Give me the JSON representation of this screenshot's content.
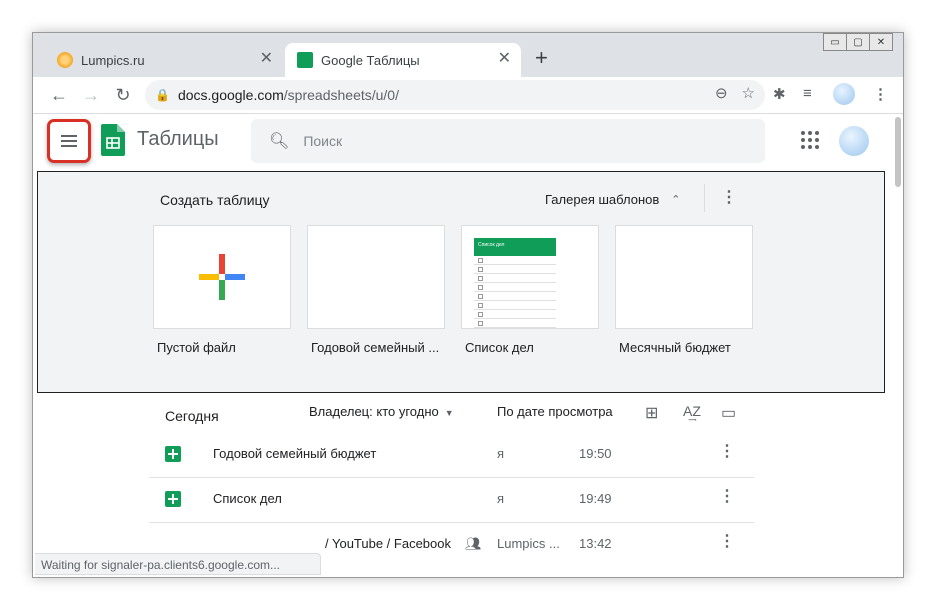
{
  "browser": {
    "tabs": [
      {
        "label": "Lumpics.ru",
        "favicon_color": "#f5a623"
      },
      {
        "label": "Google Таблицы",
        "favicon_color": "#0f9d58"
      }
    ],
    "close_glyph": "✕",
    "newtab_glyph": "+",
    "window_controls": [
      "▭",
      "▢",
      "✕"
    ],
    "url_host": "docs.google.com",
    "url_path": "/spreadsheets/u/0/",
    "nav_icons": [
      "arrow-left-icon",
      "arrow-right-icon",
      "reload-icon"
    ]
  },
  "app": {
    "title": "Таблицы",
    "search_placeholder": "Поиск",
    "brand_color": "#0f9d58"
  },
  "templates": {
    "title": "Создать таблицу",
    "gallery_label": "Галерея шаблонов",
    "items": [
      {
        "label": "Пустой файл"
      },
      {
        "label": "Годовой семейный ..."
      },
      {
        "label": "Список дел",
        "preview_title": "Список дел"
      },
      {
        "label": "Месячный бюджет"
      }
    ]
  },
  "files": {
    "section_title": "Сегодня",
    "owner_filter": "Владелец: кто угодно",
    "sort_label": "По дате просмотра",
    "rows": [
      {
        "name": "Годовой семейный бюджет",
        "owner": "я",
        "time": "19:50"
      },
      {
        "name": "Список дел",
        "owner": "я",
        "time": "19:49"
      },
      {
        "name": "/ YouTube / Facebook",
        "owner": "Lumpics ...",
        "time": "13:42"
      }
    ]
  },
  "status": {
    "text": "Waiting for signaler-pa.clients6.google.com..."
  }
}
